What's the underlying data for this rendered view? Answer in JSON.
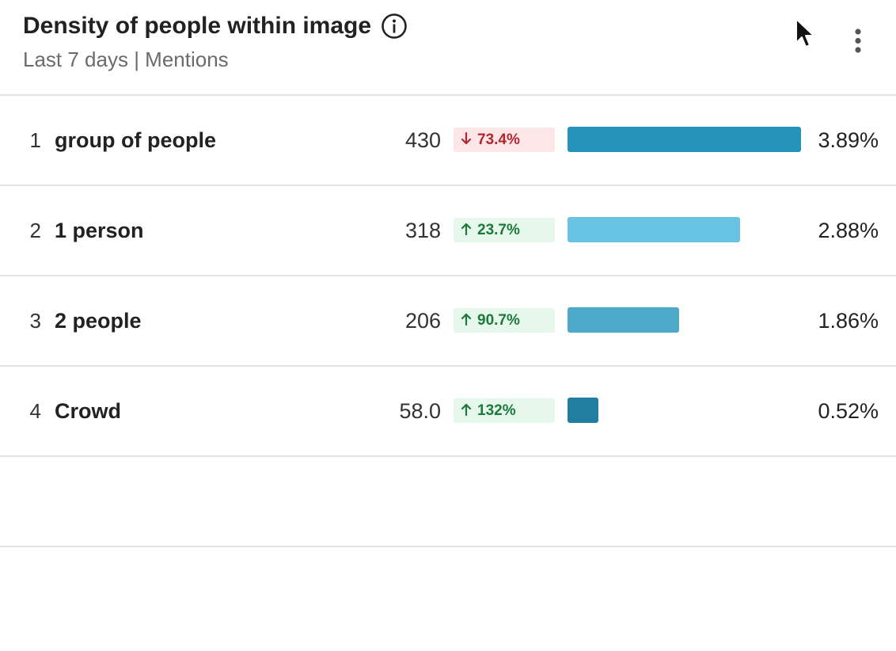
{
  "widget": {
    "title": "Density of people within image",
    "subtitle": "Last 7 days | Mentions"
  },
  "icons": {
    "info": "info-icon",
    "menu": "more-vertical-icon",
    "cursor": "mouse-pointer-icon"
  },
  "colors": {
    "up_text": "#1c7a3a",
    "up_bg": "#e6f7ec",
    "down_text": "#b3262f",
    "down_bg": "#fde6e8"
  },
  "rows": [
    {
      "rank": "1",
      "label": "group of people",
      "count": "430",
      "change": "73.4%",
      "direction": "down",
      "share": 3.89,
      "share_label": "3.89%",
      "bar_color": "#2494bb"
    },
    {
      "rank": "2",
      "label": "1 person",
      "count": "318",
      "change": "23.7%",
      "direction": "up",
      "share": 2.88,
      "share_label": "2.88%",
      "bar_color": "#67c3e3"
    },
    {
      "rank": "3",
      "label": "2 people",
      "count": "206",
      "change": "90.7%",
      "direction": "up",
      "share": 1.86,
      "share_label": "1.86%",
      "bar_color": "#4eaacb"
    },
    {
      "rank": "4",
      "label": "Crowd",
      "count": "58.0",
      "change": "132%",
      "direction": "up",
      "share": 0.52,
      "share_label": "0.52%",
      "bar_color": "#207fa1"
    }
  ]
}
